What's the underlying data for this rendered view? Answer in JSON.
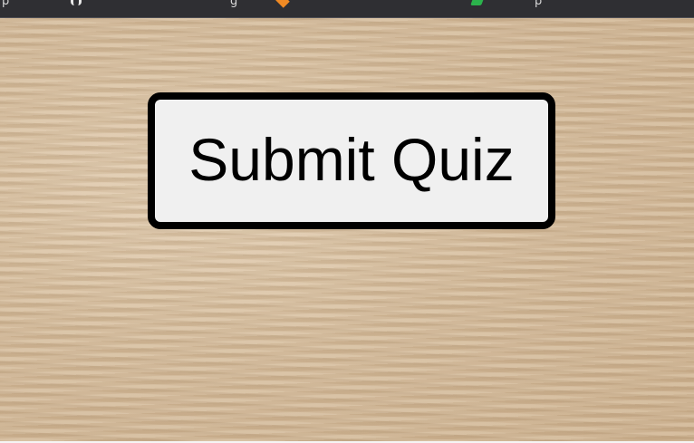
{
  "bookmarks_bar": {
    "fragments": [
      "p",
      "g",
      "p"
    ],
    "icons": [
      "bookmark-icon",
      "orange-diamond-icon",
      "green-tag-icon"
    ]
  },
  "quiz": {
    "submit_label": "Submit Quiz"
  },
  "colors": {
    "top_bar": "#2f2f33",
    "button_bg": "#f0f0f0",
    "button_border": "#000000",
    "background": "#d6bd9c"
  }
}
